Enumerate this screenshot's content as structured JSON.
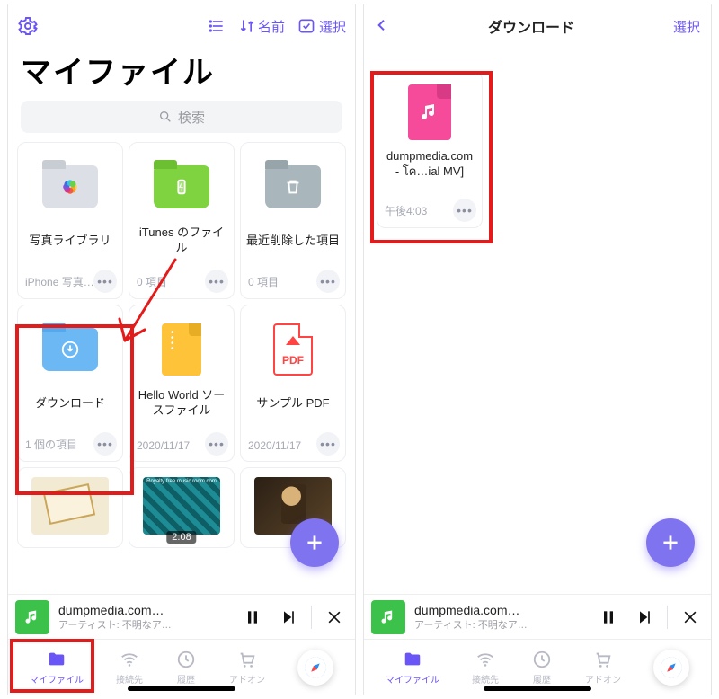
{
  "left": {
    "title": "マイファイル",
    "search_placeholder": "検索",
    "top": {
      "sort_label": "名前",
      "select_label": "選択"
    },
    "cards": [
      {
        "title": "写真ライブラリ",
        "sub": "iPhone 写真ラ…"
      },
      {
        "title": "iTunes のファイル",
        "sub": "0 項目"
      },
      {
        "title": "最近削除した項目",
        "sub": "0 項目"
      },
      {
        "title": "ダウンロード",
        "sub": "1 個の項目"
      },
      {
        "title": "Hello World ソースファイル",
        "sub": "2020/11/17"
      },
      {
        "title": "サンプル PDF",
        "sub": "2020/11/17"
      }
    ],
    "row3_time": "2:08",
    "pdf_label": "PDF"
  },
  "right": {
    "header_title": "ダウンロード",
    "select_label": "選択",
    "file_name": "dumpmedia.com - โค…ial MV]",
    "file_time": "午後4:03"
  },
  "player": {
    "title": "dumpmedia.com…",
    "artist": "アーティスト: 不明なア…"
  },
  "tabs": {
    "myfiles": "マイファイル",
    "connect": "接続先",
    "history": "履歴",
    "addon": "アドオン"
  }
}
